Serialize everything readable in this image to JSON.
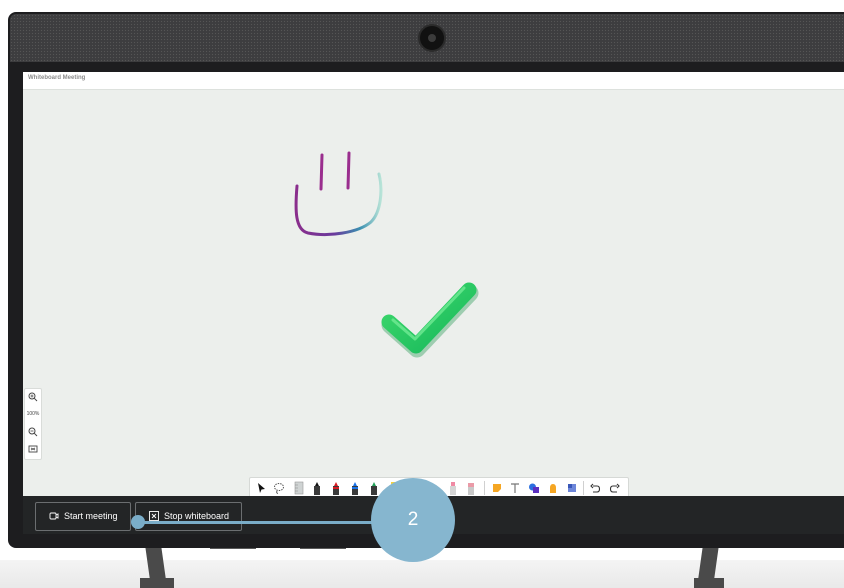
{
  "window": {
    "title": "Whiteboard Meeting"
  },
  "zoom": {
    "zoom_in_icon": "zoom-in-icon",
    "level": "100%",
    "zoom_out_icon": "zoom-out-icon",
    "fit_icon": "fit-screen-icon"
  },
  "toolbar": {
    "tools": [
      "select-arrow-icon",
      "lasso-icon",
      "ruler-icon",
      "black-pen-icon",
      "red-pen-icon",
      "blue-pen-icon",
      "green-pen-icon",
      "yellow-highlighter-icon",
      "pink-highlighter-icon",
      "eraser-icon",
      "sticky-note-icon",
      "text-icon",
      "shapes-icon",
      "reactions-icon",
      "templates-icon",
      "undo-icon",
      "redo-icon"
    ]
  },
  "actions": {
    "start_meeting_label": "Start meeting",
    "stop_whiteboard_label": "Stop whiteboard"
  },
  "callout": {
    "number": "2"
  },
  "colors": {
    "accent": "#7aadc8",
    "check": "#22c55e",
    "bar": "#232526"
  }
}
